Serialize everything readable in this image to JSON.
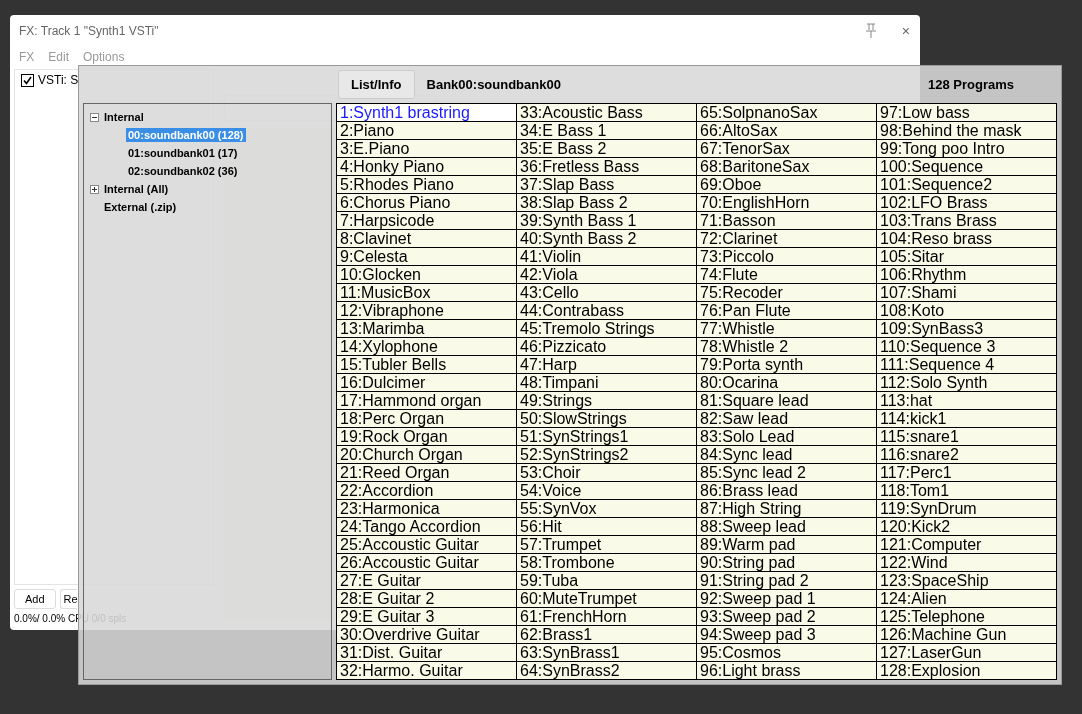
{
  "window": {
    "title": "FX: Track 1 \"Synth1 VSTi\"",
    "close": "×",
    "menu": [
      "FX",
      "Edit",
      "Options"
    ]
  },
  "fx_list": [
    {
      "label": "VSTi: S",
      "checked": true
    }
  ],
  "buttons": [
    "Add",
    "Re"
  ],
  "status": "0.0%/ 0.0% CPU 0/0 spls",
  "browser": {
    "tab": "List/Info",
    "bank": "Bank00:soundbank00",
    "count": "128 Programs",
    "tree": [
      {
        "label": "Internal",
        "expanded": true,
        "children": [
          {
            "label": "00:soundbank00 (128)",
            "selected": true
          },
          {
            "label": "01:soundbank01 (17)",
            "selected": false
          },
          {
            "label": "02:soundbank02 (36)",
            "selected": false
          }
        ],
        "selected": false
      },
      {
        "label": "Internal (All)",
        "expanded": false,
        "selected": false
      },
      {
        "label": "External (.zip)",
        "selected": false
      }
    ],
    "programs": [
      {
        "name": "1:Synth1 brastring",
        "selected": true
      },
      {
        "name": "2:Piano",
        "selected": false
      },
      {
        "name": "3:E.Piano",
        "selected": false
      },
      {
        "name": "4:Honky Piano",
        "selected": false
      },
      {
        "name": "5:Rhodes Piano",
        "selected": false
      },
      {
        "name": "6:Chorus Piano",
        "selected": false
      },
      {
        "name": "7:Harpsicode",
        "selected": false
      },
      {
        "name": "8:Clavinet",
        "selected": false
      },
      {
        "name": "9:Celesta",
        "selected": false
      },
      {
        "name": "10:Glocken",
        "selected": false
      },
      {
        "name": "11:MusicBox",
        "selected": false
      },
      {
        "name": "12:Vibraphone",
        "selected": false
      },
      {
        "name": "13:Marimba",
        "selected": false
      },
      {
        "name": "14:Xylophone",
        "selected": false
      },
      {
        "name": "15:Tubler Bells",
        "selected": false
      },
      {
        "name": "16:Dulcimer",
        "selected": false
      },
      {
        "name": "17:Hammond organ",
        "selected": false
      },
      {
        "name": "18:Perc Organ",
        "selected": false
      },
      {
        "name": "19:Rock Organ",
        "selected": false
      },
      {
        "name": "20:Church Organ",
        "selected": false
      },
      {
        "name": "21:Reed Organ",
        "selected": false
      },
      {
        "name": "22:Accordion",
        "selected": false
      },
      {
        "name": "23:Harmonica",
        "selected": false
      },
      {
        "name": "24:Tango Accordion",
        "selected": false
      },
      {
        "name": "25:Accoustic Guitar",
        "selected": false
      },
      {
        "name": "26:Accoustic Guitar",
        "selected": false
      },
      {
        "name": "27:E Guitar",
        "selected": false
      },
      {
        "name": "28:E Guitar 2",
        "selected": false
      },
      {
        "name": "29:E Guitar 3",
        "selected": false
      },
      {
        "name": "30:Overdrive Guitar",
        "selected": false
      },
      {
        "name": "31:Dist. Guitar",
        "selected": false
      },
      {
        "name": "32:Harmo. Guitar",
        "selected": false
      },
      {
        "name": "33:Acoustic Bass",
        "selected": false
      },
      {
        "name": "34:E Bass 1",
        "selected": false
      },
      {
        "name": "35:E Bass 2",
        "selected": false
      },
      {
        "name": "36:Fretless Bass",
        "selected": false
      },
      {
        "name": "37:Slap Bass",
        "selected": false
      },
      {
        "name": "38:Slap Bass 2",
        "selected": false
      },
      {
        "name": "39:Synth Bass 1",
        "selected": false
      },
      {
        "name": "40:Synth Bass 2",
        "selected": false
      },
      {
        "name": "41:Violin",
        "selected": false
      },
      {
        "name": "42:Viola",
        "selected": false
      },
      {
        "name": "43:Cello",
        "selected": false
      },
      {
        "name": "44:Contrabass",
        "selected": false
      },
      {
        "name": "45:Tremolo Strings",
        "selected": false
      },
      {
        "name": "46:Pizzicato",
        "selected": false
      },
      {
        "name": "47:Harp",
        "selected": false
      },
      {
        "name": "48:Timpani",
        "selected": false
      },
      {
        "name": "49:Strings",
        "selected": false
      },
      {
        "name": "50:SlowStrings",
        "selected": false
      },
      {
        "name": "51:SynStrings1",
        "selected": false
      },
      {
        "name": "52:SynStrings2",
        "selected": false
      },
      {
        "name": "53:Choir",
        "selected": false
      },
      {
        "name": "54:Voice",
        "selected": false
      },
      {
        "name": "55:SynVox",
        "selected": false
      },
      {
        "name": "56:Hit",
        "selected": false
      },
      {
        "name": "57:Trumpet",
        "selected": false
      },
      {
        "name": "58:Trombone",
        "selected": false
      },
      {
        "name": "59:Tuba",
        "selected": false
      },
      {
        "name": "60:MuteTrumpet",
        "selected": false
      },
      {
        "name": "61:FrenchHorn",
        "selected": false
      },
      {
        "name": "62:Brass1",
        "selected": false
      },
      {
        "name": "63:SynBrass1",
        "selected": false
      },
      {
        "name": "64:SynBrass2",
        "selected": false
      },
      {
        "name": "65:SolpnanoSax",
        "selected": false
      },
      {
        "name": "66:AltoSax",
        "selected": false
      },
      {
        "name": "67:TenorSax",
        "selected": false
      },
      {
        "name": "68:BaritoneSax",
        "selected": false
      },
      {
        "name": "69:Oboe",
        "selected": false
      },
      {
        "name": "70:EnglishHorn",
        "selected": false
      },
      {
        "name": "71:Basson",
        "selected": false
      },
      {
        "name": "72:Clarinet",
        "selected": false
      },
      {
        "name": "73:Piccolo",
        "selected": false
      },
      {
        "name": "74:Flute",
        "selected": false
      },
      {
        "name": "75:Recoder",
        "selected": false
      },
      {
        "name": "76:Pan Flute",
        "selected": false
      },
      {
        "name": "77:Whistle",
        "selected": false
      },
      {
        "name": "78:Whistle 2",
        "selected": false
      },
      {
        "name": "79:Porta synth",
        "selected": false
      },
      {
        "name": "80:Ocarina",
        "selected": false
      },
      {
        "name": "81:Square lead",
        "selected": false
      },
      {
        "name": "82:Saw lead",
        "selected": false
      },
      {
        "name": "83:Solo Lead",
        "selected": false
      },
      {
        "name": "84:Sync lead",
        "selected": false
      },
      {
        "name": "85:Sync lead 2",
        "selected": false
      },
      {
        "name": "86:Brass lead",
        "selected": false
      },
      {
        "name": "87:High String",
        "selected": false
      },
      {
        "name": "88:Sweep lead",
        "selected": false
      },
      {
        "name": "89:Warm pad",
        "selected": false
      },
      {
        "name": "90:String pad",
        "selected": false
      },
      {
        "name": "91:String pad 2",
        "selected": false
      },
      {
        "name": "92:Sweep pad 1",
        "selected": false
      },
      {
        "name": "93:Sweep pad 2",
        "selected": false
      },
      {
        "name": "94:Sweep pad 3",
        "selected": false
      },
      {
        "name": "95:Cosmos",
        "selected": false
      },
      {
        "name": "96:Light brass",
        "selected": false
      },
      {
        "name": "97:Low bass",
        "selected": false
      },
      {
        "name": "98:Behind the mask",
        "selected": false
      },
      {
        "name": "99:Tong poo Intro",
        "selected": false
      },
      {
        "name": "100:Sequence",
        "selected": false
      },
      {
        "name": "101:Sequence2",
        "selected": false
      },
      {
        "name": "102:LFO Brass",
        "selected": false
      },
      {
        "name": "103:Trans Brass",
        "selected": false
      },
      {
        "name": "104:Reso brass",
        "selected": false
      },
      {
        "name": "105:Sitar",
        "selected": false
      },
      {
        "name": "106:Rhythm",
        "selected": false
      },
      {
        "name": "107:Shami",
        "selected": false
      },
      {
        "name": "108:Koto",
        "selected": false
      },
      {
        "name": "109:SynBass3",
        "selected": false
      },
      {
        "name": "110:Sequence 3",
        "selected": false
      },
      {
        "name": "111:Sequence 4",
        "selected": false
      },
      {
        "name": "112:Solo Synth",
        "selected": false
      },
      {
        "name": "113:hat",
        "selected": false
      },
      {
        "name": "114:kick1",
        "selected": false
      },
      {
        "name": "115:snare1",
        "selected": false
      },
      {
        "name": "116:snare2",
        "selected": false
      },
      {
        "name": "117:Perc1",
        "selected": false
      },
      {
        "name": "118:Tom1",
        "selected": false
      },
      {
        "name": "119:SynDrum",
        "selected": false
      },
      {
        "name": "120:Kick2",
        "selected": false
      },
      {
        "name": "121:Computer",
        "selected": false
      },
      {
        "name": "122:Wind",
        "selected": false
      },
      {
        "name": "123:SpaceShip",
        "selected": false
      },
      {
        "name": "124:Alien",
        "selected": false
      },
      {
        "name": "125:Telephone",
        "selected": false
      },
      {
        "name": "126:Machine Gun",
        "selected": false
      },
      {
        "name": "127:LaserGun",
        "selected": false
      },
      {
        "name": "128:Explosion",
        "selected": false
      }
    ]
  }
}
